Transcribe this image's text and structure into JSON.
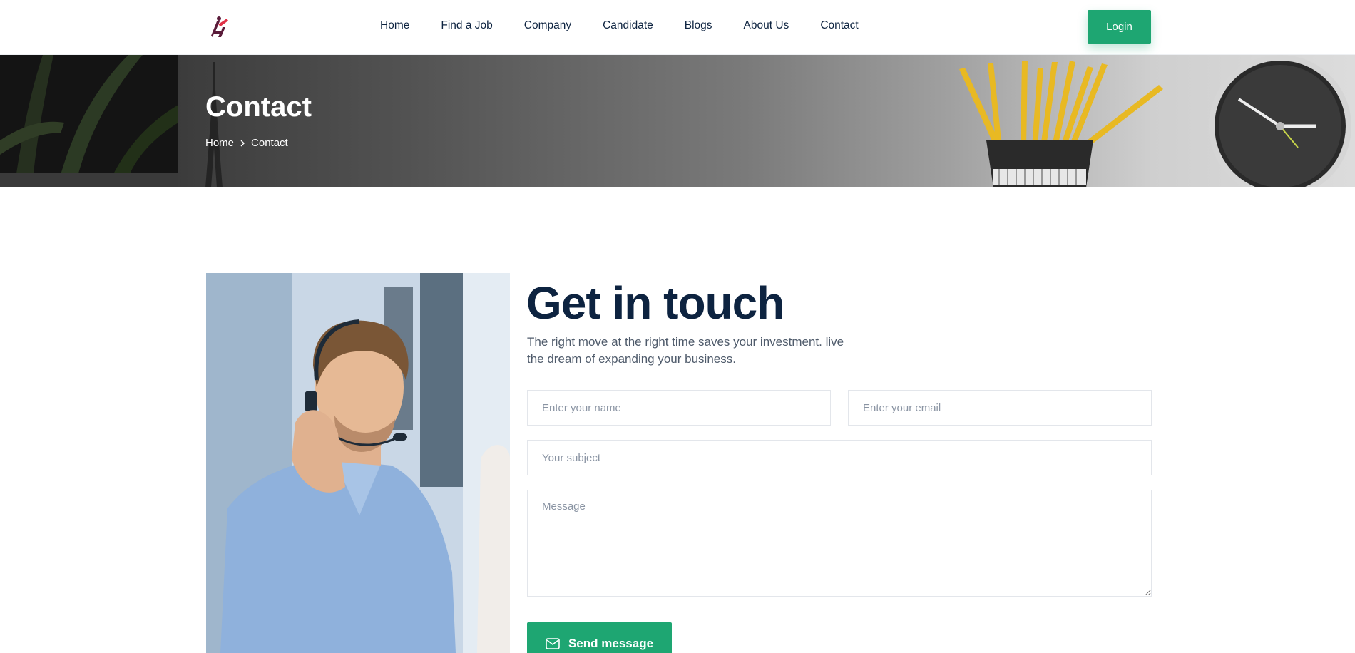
{
  "header": {
    "logo": "logo-icon",
    "nav": [
      "Home",
      "Find a Job",
      "Company",
      "Candidate",
      "Blogs",
      "About Us",
      "Contact"
    ],
    "login_label": "Login"
  },
  "banner": {
    "title": "Contact",
    "breadcrumb": {
      "home": "Home",
      "current": "Contact"
    }
  },
  "contact": {
    "heading": "Get in touch",
    "subtext": "The right move at the right time saves your investment. live the dream of expanding your business.",
    "name_placeholder": "Enter your name",
    "email_placeholder": "Enter your email",
    "subject_placeholder": "Your subject",
    "message_placeholder": "Message",
    "send_label": "Send message",
    "send_icon": "envelope-icon"
  },
  "colors": {
    "accent": "#1ea672",
    "heading": "#0d2340"
  }
}
